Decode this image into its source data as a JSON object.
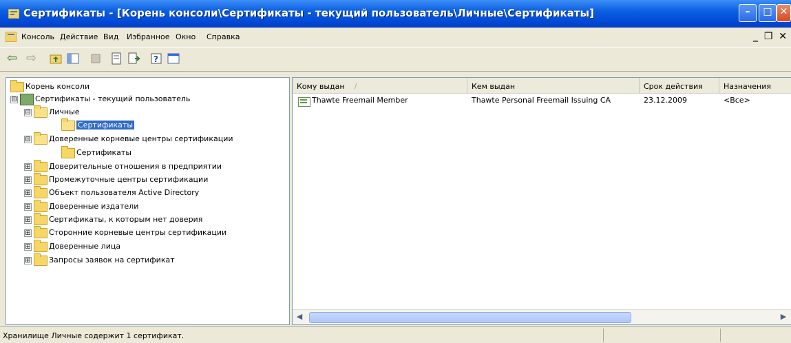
{
  "window": {
    "title": "Сертификаты - [Корень консоли\\Сертификаты - текущий пользователь\\Личные\\Сертификаты]",
    "min_glyph": "–",
    "max_glyph": "□",
    "close_glyph": "✕"
  },
  "menubar": {
    "items": [
      "Консоль",
      "Действие",
      "Вид",
      "Избранное",
      "Окно",
      "Справка"
    ],
    "mdi_controls": "_ ❐ ✕"
  },
  "toolbar": {
    "back_glyph": "⇦",
    "forward_glyph": "⇨",
    "icons": [
      "up-folder-icon",
      "show-hide-tree-icon",
      "delete-icon",
      "properties-icon",
      "export-list-icon",
      "help-icon",
      "new-window-icon"
    ]
  },
  "tree": {
    "items": [
      {
        "label": "Корень консоли"
      },
      {
        "label": "Сертификаты - текущий пользователь",
        "expander": "⊟"
      },
      {
        "label": "Личные",
        "expander": "⊟"
      },
      {
        "label": "Сертификаты",
        "selected": true
      },
      {
        "label": "Доверенные корневые центры сертификации",
        "expander": "⊟"
      },
      {
        "label": "Сертификаты"
      },
      {
        "label": "Доверительные отношения в предприятии",
        "expander": "⊞"
      },
      {
        "label": "Промежуточные центры сертификации",
        "expander": "⊞"
      },
      {
        "label": "Объект пользователя Active Directory",
        "expander": "⊞"
      },
      {
        "label": "Доверенные издатели",
        "expander": "⊞"
      },
      {
        "label": "Сертификаты, к которым нет доверия",
        "expander": "⊞"
      },
      {
        "label": "Сторонние корневые центры сертификации",
        "expander": "⊞"
      },
      {
        "label": "Доверенные лица",
        "expander": "⊞"
      },
      {
        "label": "Запросы заявок на сертификат",
        "expander": "⊞"
      }
    ]
  },
  "list": {
    "columns": [
      "Кому выдан",
      "Кем выдан",
      "Срок действия",
      "Назначения"
    ],
    "sort_indicator": "/",
    "rows": [
      {
        "issued_to": "Thawte Freemail Member",
        "issued_by": "Thawte Personal Freemail Issuing CA",
        "expires": "23.12.2009",
        "purposes": "<Все>"
      }
    ]
  },
  "scrollbar": {
    "left_arrow": "◀",
    "right_arrow": "▶"
  },
  "statusbar": {
    "text": "Хранилище Личные содержит 1 сертификат."
  },
  "colors": {
    "title_blue": "#0a5fe0",
    "selection": "#316ac5",
    "folder_yellow": "#f6d766",
    "close_red": "#d24a20"
  }
}
